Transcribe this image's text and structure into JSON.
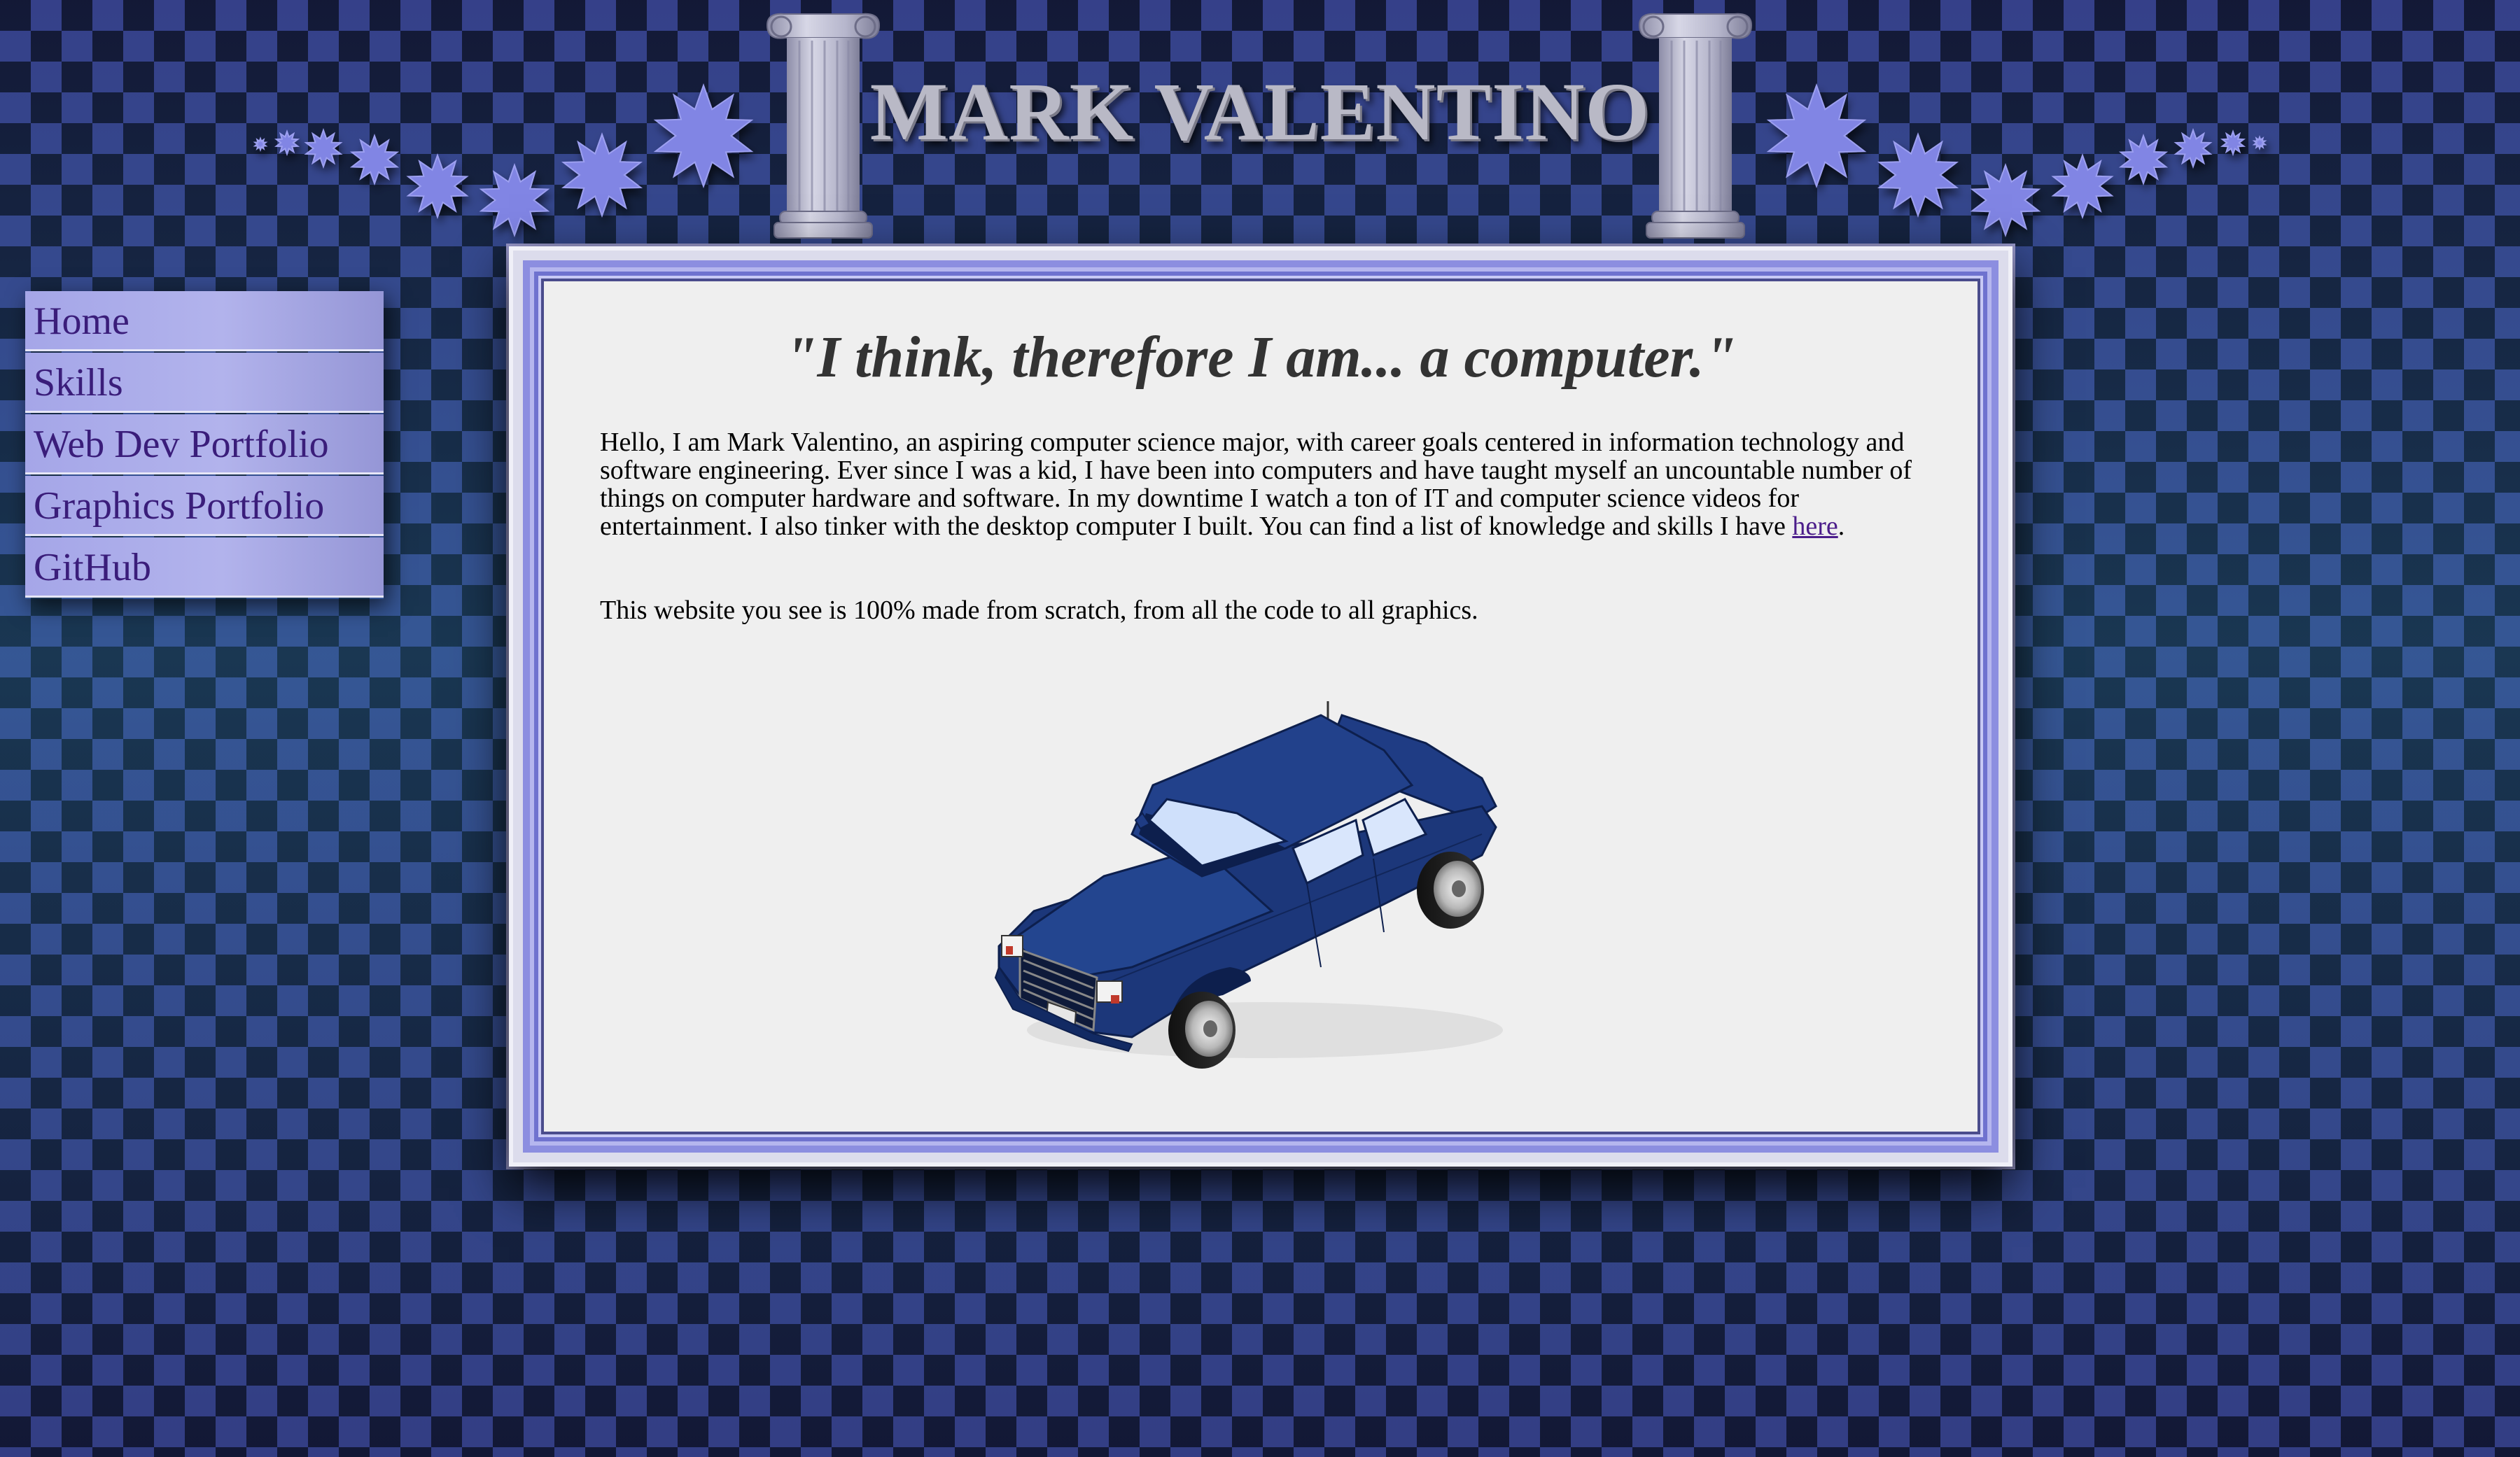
{
  "header": {
    "title": "MARK VALENTINO"
  },
  "nav": {
    "items": [
      {
        "label": "Home"
      },
      {
        "label": "Skills"
      },
      {
        "label": "Web Dev Portfolio"
      },
      {
        "label": "Graphics Portfolio"
      },
      {
        "label": "GitHub"
      }
    ]
  },
  "main": {
    "quote": "\"I think, therefore I am... a computer.\"",
    "intro_text": "Hello, I am Mark Valentino, an aspiring computer science major, with career goals centered in information technology and software engineering. Ever since I was a kid, I have been into computers and have taught myself an uncountable number of things on computer hardware and software. In my downtime I watch a ton of IT and computer science videos for entertainment. I also tinker with the desktop computer I built. You can find a list of knowledge and skills I have ",
    "intro_link": "here",
    "intro_end": ".",
    "note": "This website you see is 100% made from scratch, from all the code to all graphics."
  },
  "colors": {
    "checker_light": "#3a4694",
    "checker_dark": "#141a38",
    "nav_bg": "#a5a6e8",
    "nav_text": "#3a1d7a",
    "frame_border": "#8c8ee0",
    "content_bg": "#efefef",
    "car_body": "#1f3c84",
    "star": "#8185e4"
  },
  "icons": {
    "stars": "star-icon",
    "columns": "ionic-column-icon",
    "car": "car-illustration"
  }
}
